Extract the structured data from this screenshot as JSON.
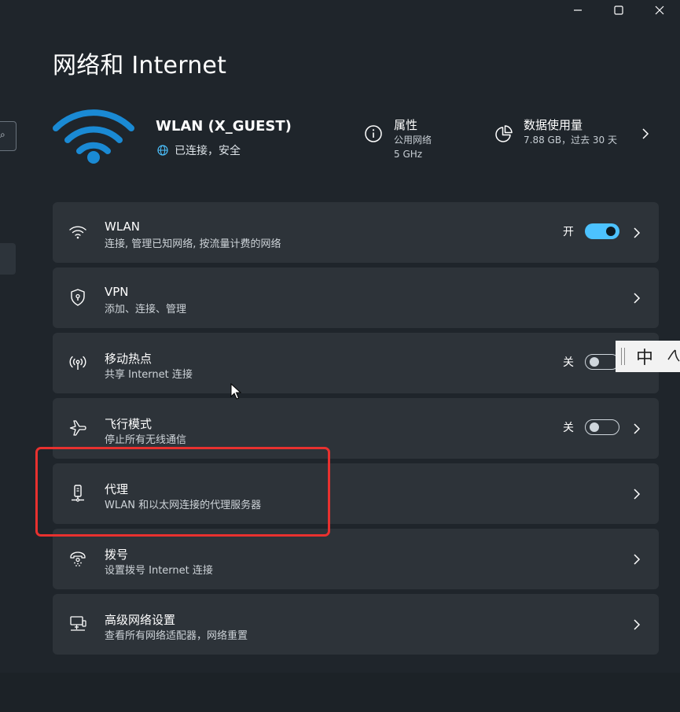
{
  "window": {
    "controls": {
      "minimize_icon": "minimize-icon",
      "maximize_icon": "maximize-icon",
      "close_icon": "close-icon"
    }
  },
  "page": {
    "title": "网络和 Internet"
  },
  "connection": {
    "name": "WLAN (X_GUEST)",
    "status": "已连接，安全",
    "icon": "wifi-icon",
    "status_icon": "globe-icon"
  },
  "properties": {
    "title": "属性",
    "network_type": "公用网络",
    "band": "5 GHz",
    "icon": "info-icon"
  },
  "data_usage": {
    "title": "数据使用量",
    "detail": "7.88 GB，过去 30 天",
    "icon": "pie-chart-icon"
  },
  "items": [
    {
      "label": "WLAN",
      "sub": "连接, 管理已知网络, 按流量计费的网络",
      "icon": "wifi-icon",
      "toggle": true,
      "toggle_text": "开",
      "toggle_on": true
    },
    {
      "label": "VPN",
      "sub": "添加、连接、管理",
      "icon": "shield-icon",
      "toggle": false
    },
    {
      "label": "移动热点",
      "sub": "共享 Internet 连接",
      "icon": "hotspot-icon",
      "toggle": true,
      "toggle_text": "关",
      "toggle_on": false
    },
    {
      "label": "飞行模式",
      "sub": "停止所有无线通信",
      "icon": "airplane-icon",
      "toggle": true,
      "toggle_text": "关",
      "toggle_on": false
    },
    {
      "label": "代理",
      "sub": "WLAN 和以太网连接的代理服务器",
      "icon": "proxy-icon",
      "toggle": false
    },
    {
      "label": "拨号",
      "sub": "设置拨号 Internet 连接",
      "icon": "dialup-icon",
      "toggle": false
    },
    {
      "label": "高级网络设置",
      "sub": "查看所有网络适配器，网络重置",
      "icon": "computer-network-icon",
      "toggle": false
    }
  ],
  "ime": {
    "mode_char": "中",
    "moon_icon": "moon-icon"
  },
  "colors": {
    "background": "#1f252b",
    "card": "#2d3339",
    "accent": "#4cc2ff",
    "wifi_hero": "#1a8ad4",
    "highlight": "#e8312f"
  }
}
